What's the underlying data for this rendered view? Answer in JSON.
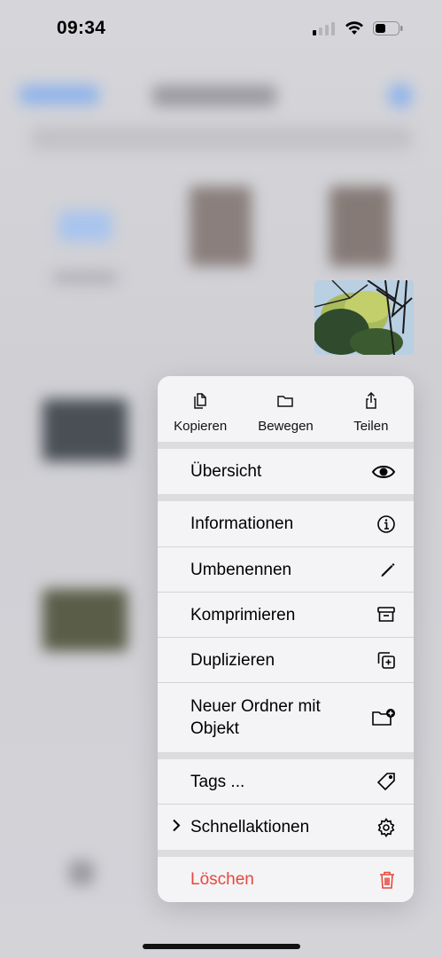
{
  "status_bar": {
    "time": "09:34"
  },
  "context_menu": {
    "actions": [
      {
        "label": "Kopieren",
        "icon": "copy-icon"
      },
      {
        "label": "Bewegen",
        "icon": "folder-icon"
      },
      {
        "label": "Teilen",
        "icon": "share-icon"
      }
    ],
    "items": {
      "overview": {
        "label": "Übersicht",
        "icon": "eye-icon"
      },
      "info": {
        "label": "Informationen",
        "icon": "info-icon"
      },
      "rename": {
        "label": "Umbenennen",
        "icon": "pencil-icon"
      },
      "compress": {
        "label": "Komprimieren",
        "icon": "archive-icon"
      },
      "duplicate": {
        "label": "Duplizieren",
        "icon": "duplicate-icon"
      },
      "new_folder": {
        "label": "Neuer Ordner mit Objekt",
        "icon": "folder-plus-icon"
      },
      "tags": {
        "label": "Tags ...",
        "icon": "tag-icon"
      },
      "quick_actions": {
        "label": "Schnellaktionen",
        "icon": "gear-icon"
      },
      "delete": {
        "label": "Löschen",
        "icon": "trash-icon",
        "color": "#e5483c"
      }
    }
  },
  "colors": {
    "destructive": "#e5483c",
    "menu_bg": "#f4f4f6"
  }
}
